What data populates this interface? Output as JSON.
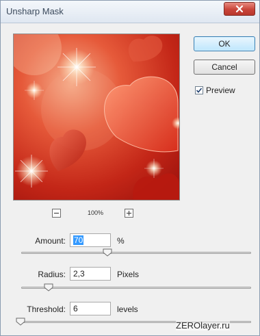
{
  "window": {
    "title": "Unsharp Mask"
  },
  "buttons": {
    "ok": "OK",
    "cancel": "Cancel"
  },
  "preview_checkbox": {
    "label": "Preview",
    "checked": true
  },
  "zoom": {
    "level": "100%",
    "minus": "−",
    "plus": "+"
  },
  "params": {
    "amount": {
      "label": "Amount:",
      "value": "70",
      "unit": "%",
      "slider_value": 70,
      "slider_max": 500
    },
    "radius": {
      "label": "Radius:",
      "value": "2,3",
      "unit": "Pixels",
      "slider_value": 2.3,
      "slider_max": 250
    },
    "threshold": {
      "label": "Threshold:",
      "value": "6",
      "unit": "levels",
      "slider_value": 6,
      "slider_max": 255
    }
  },
  "watermark": "ZEROlayer.ru",
  "colors": {
    "preview_red": "#c62a1c",
    "selection": "#3399ff",
    "close": "#c9453a"
  }
}
